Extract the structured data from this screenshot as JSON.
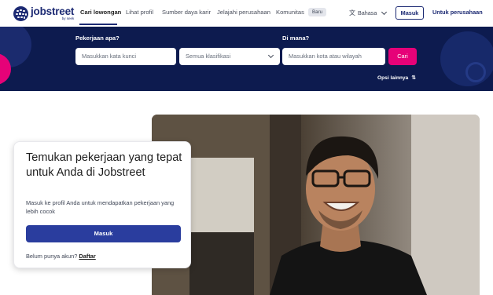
{
  "brand": {
    "name": "jobstreet",
    "sub": "by seek"
  },
  "nav": {
    "links": [
      "Cari lowongan",
      "Lihat profil",
      "Sumber daya karir",
      "Jelajahi perusahaan",
      "Komunitas"
    ],
    "badge": "Baru",
    "language": "Bahasa",
    "login": "Masuk",
    "employer": "Untuk perusahaan"
  },
  "search": {
    "what_label": "Pekerjaan apa?",
    "keyword_placeholder": "Masukkan kata kunci",
    "classification": "Semua klasifikasi",
    "where_label": "Di mana?",
    "location_placeholder": "Masukkan kota atau wilayah",
    "submit": "Cari",
    "more_options": "Opsi lainnya"
  },
  "promo": {
    "title": "Temukan pekerjaan yang tepat untuk Anda di Jobstreet",
    "description": "Masuk ke profil Anda untuk mendapatkan pekerjaan yang lebih cocok",
    "login_button": "Masuk",
    "no_account": "Belum punya akun?",
    "signup_link": "Daftar"
  },
  "colors": {
    "brand_navy": "#1c2a73",
    "hero_bg": "#0d1b4f",
    "accent_pink": "#e60278",
    "button_blue": "#2a3d9e"
  }
}
